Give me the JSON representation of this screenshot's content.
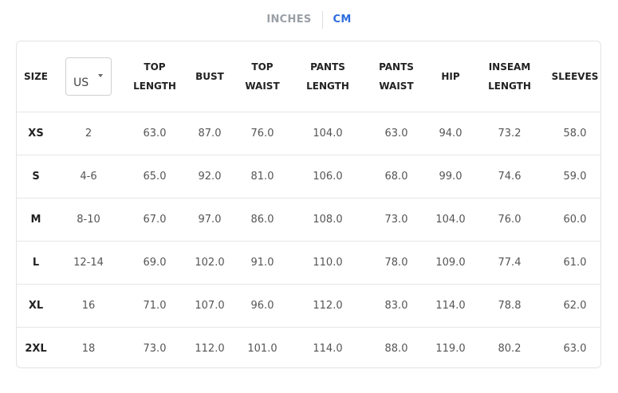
{
  "units": {
    "inches_label": "INCHES",
    "cm_label": "CM",
    "active": "CM"
  },
  "region_select": {
    "selected": "US",
    "icon": "chevron-down-icon"
  },
  "colors": {
    "active_tab": "#2d6cdf",
    "inactive_tab": "#9aa0a6"
  },
  "headers": {
    "size": "SIZE",
    "top_length": [
      "TOP",
      "LENGTH"
    ],
    "bust": "BUST",
    "top_waist": [
      "TOP",
      "WAIST"
    ],
    "pants_length": [
      "PANTS",
      "LENGTH"
    ],
    "pants_waist": [
      "PANTS",
      "WAIST"
    ],
    "hip": "HIP",
    "inseam_length": [
      "INSEAM",
      "LENGTH"
    ],
    "sleeves": "SLEEVES"
  },
  "rows": [
    {
      "size": "XS",
      "us": "2",
      "top_length": "63.0",
      "bust": "87.0",
      "top_waist": "76.0",
      "pants_length": "104.0",
      "pants_waist": "63.0",
      "hip": "94.0",
      "inseam_length": "73.2",
      "sleeves": "58.0"
    },
    {
      "size": "S",
      "us": "4-6",
      "top_length": "65.0",
      "bust": "92.0",
      "top_waist": "81.0",
      "pants_length": "106.0",
      "pants_waist": "68.0",
      "hip": "99.0",
      "inseam_length": "74.6",
      "sleeves": "59.0"
    },
    {
      "size": "M",
      "us": "8-10",
      "top_length": "67.0",
      "bust": "97.0",
      "top_waist": "86.0",
      "pants_length": "108.0",
      "pants_waist": "73.0",
      "hip": "104.0",
      "inseam_length": "76.0",
      "sleeves": "60.0"
    },
    {
      "size": "L",
      "us": "12-14",
      "top_length": "69.0",
      "bust": "102.0",
      "top_waist": "91.0",
      "pants_length": "110.0",
      "pants_waist": "78.0",
      "hip": "109.0",
      "inseam_length": "77.4",
      "sleeves": "61.0"
    },
    {
      "size": "XL",
      "us": "16",
      "top_length": "71.0",
      "bust": "107.0",
      "top_waist": "96.0",
      "pants_length": "112.0",
      "pants_waist": "83.0",
      "hip": "114.0",
      "inseam_length": "78.8",
      "sleeves": "62.0"
    },
    {
      "size": "2XL",
      "us": "18",
      "top_length": "73.0",
      "bust": "112.0",
      "top_waist": "101.0",
      "pants_length": "114.0",
      "pants_waist": "88.0",
      "hip": "119.0",
      "inseam_length": "80.2",
      "sleeves": "63.0"
    }
  ]
}
